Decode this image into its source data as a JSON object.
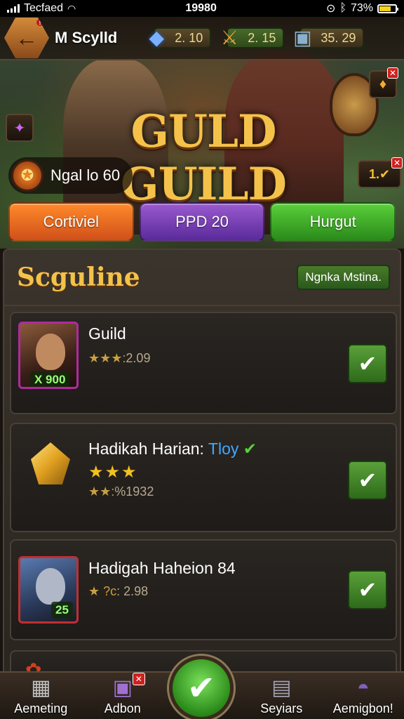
{
  "status_bar": {
    "carrier": "Tecfaed",
    "time": "19980",
    "battery": "73%"
  },
  "top_bar": {
    "player_name": "M Scylld",
    "resources": [
      {
        "icon": "gem-icon",
        "value": "2. 10"
      },
      {
        "icon": "sword-icon",
        "value": "2. 15"
      },
      {
        "icon": "chest-icon",
        "value": "35. 29"
      }
    ]
  },
  "hero": {
    "title": "GULD GUILD",
    "rank_text": "Ngal lo 60",
    "side_right_bottom": "1."
  },
  "tabs": [
    {
      "label": "Cortiviel",
      "color": "#e8691f"
    },
    {
      "label": "PPD 20",
      "color": "#7a3fbf"
    },
    {
      "label": "Hurgut",
      "color": "#3fae26"
    }
  ],
  "panel": {
    "title": "Scguline",
    "action_label": "Ngnka Mstina."
  },
  "list": [
    {
      "name": "Guild",
      "sub": "2.09",
      "badge": "X 900"
    },
    {
      "name": "Hadikah Harian:",
      "accent": "Tloy",
      "sub": "%1932"
    },
    {
      "name": "Hadigah Haheion 84",
      "sub": ":  2.98",
      "badge": "25"
    }
  ],
  "bottom_nav": [
    {
      "label": "Aemeting",
      "icon": "cube-icon"
    },
    {
      "label": "Adbon",
      "icon": "chest-icon"
    },
    {
      "label": "",
      "icon": "check-icon"
    },
    {
      "label": "Seyiars",
      "icon": "box-icon"
    },
    {
      "label": "Aemigbon!",
      "icon": "helmet-icon"
    }
  ],
  "colors": {
    "gold": "#f4c24a",
    "green": "#3fae26",
    "purple": "#7a3fbf",
    "orange": "#e8691f"
  }
}
